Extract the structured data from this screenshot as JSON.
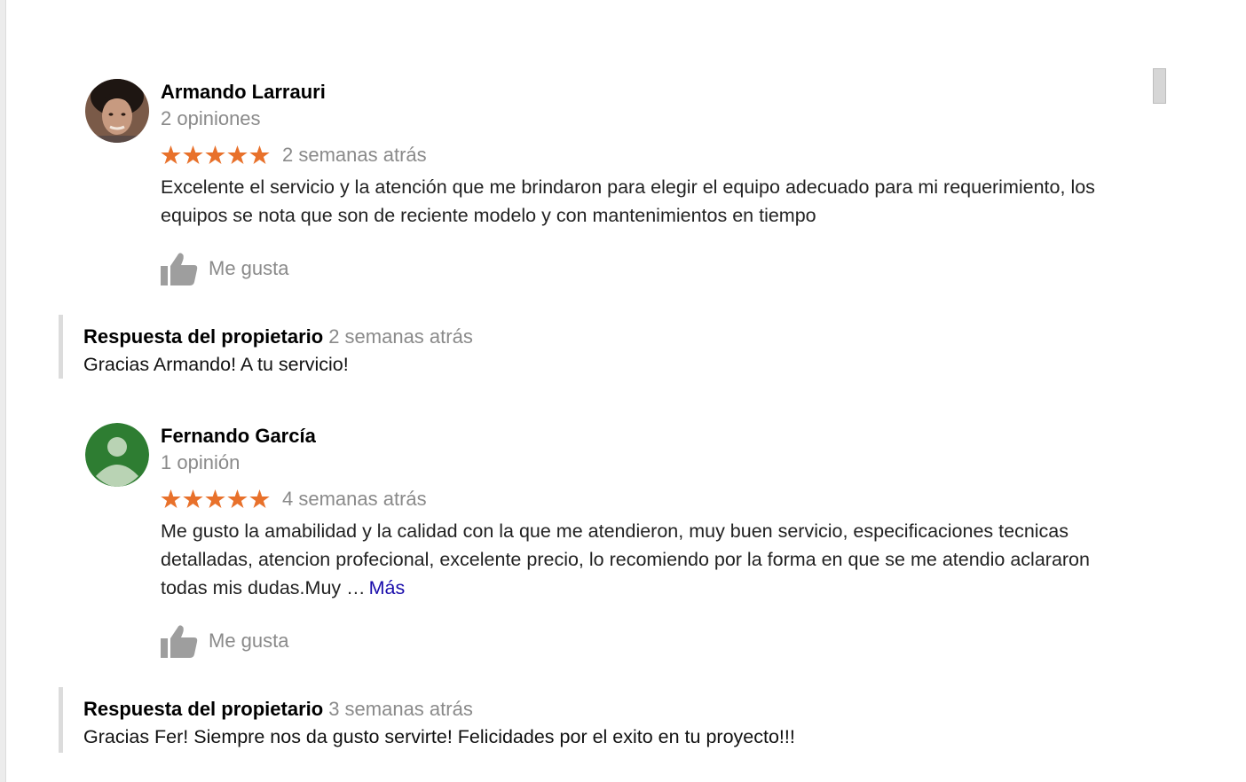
{
  "colors": {
    "star": "#e8712b",
    "muted_text": "#8a8a8a",
    "link": "#1a0dab",
    "avatar_green": "#2e7d32"
  },
  "reviews": [
    {
      "author": "Armando Larrauri",
      "review_count": "2 opiniones",
      "rating": 5,
      "time": "2 semanas atrás",
      "text": "Excelente el servicio y la atención que me brindaron para elegir el equipo adecuado para mi requerimiento, los equipos se nota que son de reciente modelo y con mantenimientos en tiempo",
      "like_label": "Me gusta",
      "owner_reply": {
        "title": "Respuesta del propietario",
        "time": "2 semanas atrás",
        "text": "Gracias Armando! A tu servicio!"
      }
    },
    {
      "author": "Fernando García",
      "review_count": "1 opinión",
      "rating": 5,
      "time": "4 semanas atrás",
      "text": "Me gusto la amabilidad y la calidad con la que me atendieron, muy buen servicio, especificaciones tecnicas detalladas, atencion profecional, excelente precio, lo recomiendo por la forma en que se me atendio aclararon todas mis dudas.Muy …",
      "more_label": "Más",
      "like_label": "Me gusta",
      "owner_reply": {
        "title": "Respuesta del propietario",
        "time": "3 semanas atrás",
        "text": "Gracias Fer! Siempre nos da gusto servirte! Felicidades por el exito en tu proyecto!!!"
      }
    }
  ]
}
